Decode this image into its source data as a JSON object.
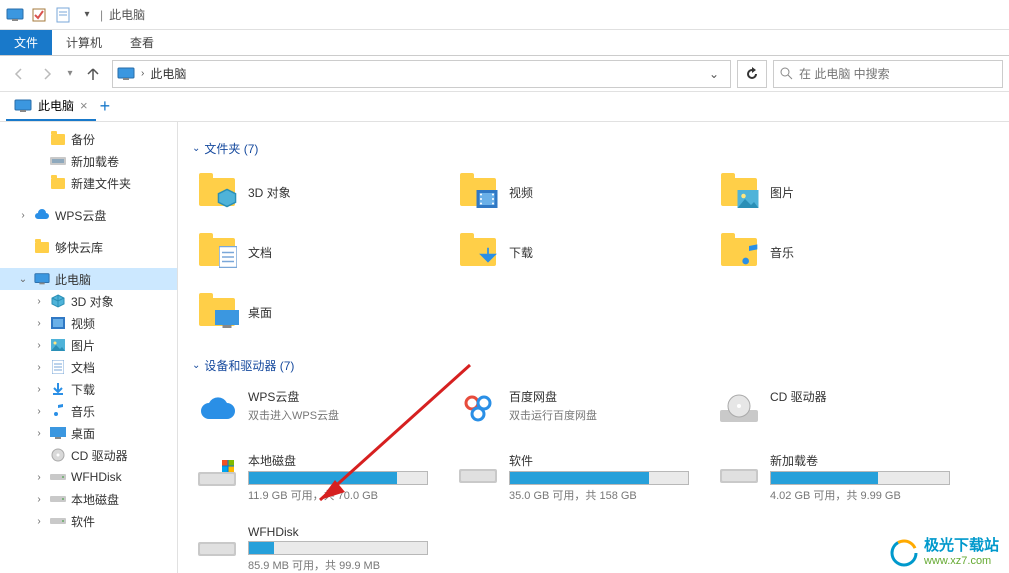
{
  "window": {
    "title": "此电脑"
  },
  "ribbon": {
    "tabs": {
      "file": "文件",
      "computer": "计算机",
      "view": "查看"
    }
  },
  "address": {
    "crumb": "此电脑",
    "search_placeholder": "在 此电脑 中搜索"
  },
  "doctab": {
    "label": "此电脑"
  },
  "sidebar": {
    "backup": "备份",
    "newvol": "新加载卷",
    "newfolder": "新建文件夹",
    "wpscloud": "WPS云盘",
    "goukuai": "够快云库",
    "thispc": "此电脑",
    "threed": "3D 对象",
    "videos": "视频",
    "pictures": "图片",
    "documents": "文档",
    "downloads": "下载",
    "music": "音乐",
    "desktop": "桌面",
    "cddrive": "CD 驱动器",
    "wfhdisk": "WFHDisk",
    "localdisk": "本地磁盘",
    "software": "软件"
  },
  "sections": {
    "folders_header": "文件夹 (7)",
    "drives_header": "设备和驱动器 (7)"
  },
  "folders": {
    "threed": "3D 对象",
    "videos": "视频",
    "pictures": "图片",
    "documents": "文档",
    "downloads": "下载",
    "music": "音乐",
    "desktop": "桌面"
  },
  "drives": {
    "wps": {
      "name": "WPS云盘",
      "sub": "双击进入WPS云盘"
    },
    "baidu": {
      "name": "百度网盘",
      "sub": "双击运行百度网盘"
    },
    "cd": {
      "name": "CD 驱动器"
    },
    "local": {
      "name": "本地磁盘",
      "sub": "11.9 GB 可用，共 70.0 GB",
      "fill": 83
    },
    "soft": {
      "name": "软件",
      "sub": "35.0 GB 可用，共 158 GB",
      "fill": 78
    },
    "newvol": {
      "name": "新加载卷",
      "sub": "4.02 GB 可用，共 9.99 GB",
      "fill": 60
    },
    "wfh": {
      "name": "WFHDisk",
      "sub": "85.9 MB 可用，共 99.9 MB",
      "fill": 14
    }
  },
  "watermark": {
    "title": "极光下载站",
    "url": "www.xz7.com"
  }
}
